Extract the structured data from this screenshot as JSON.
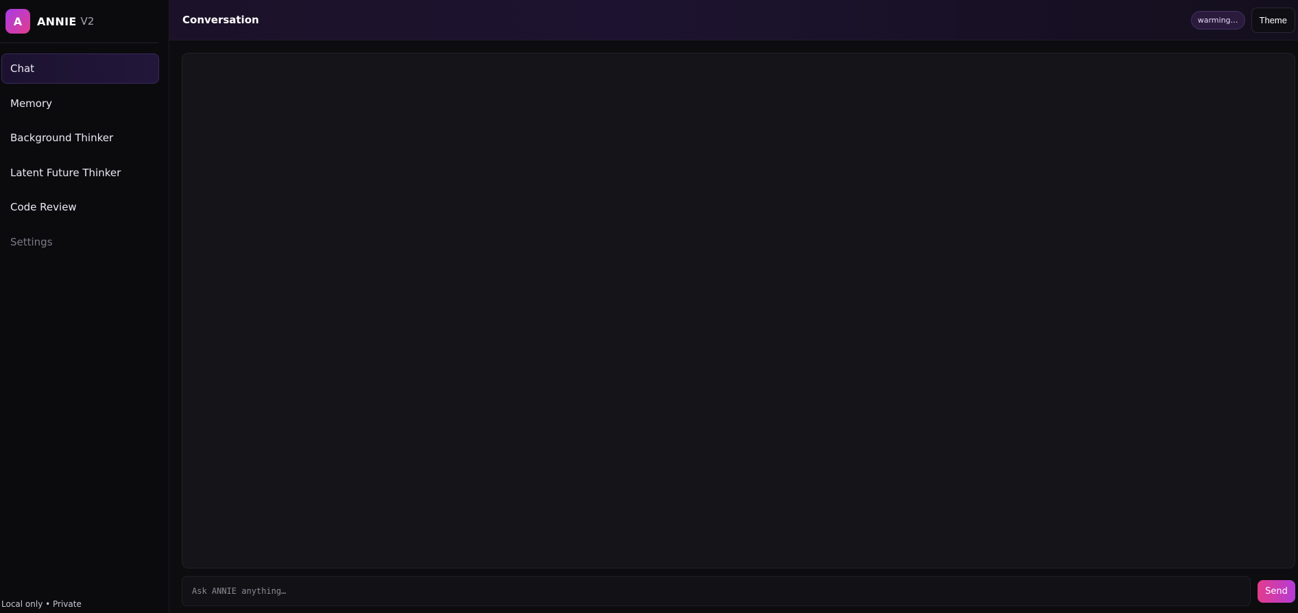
{
  "brand": {
    "logo_letter": "A",
    "name": "ANNIE",
    "version": "V2"
  },
  "sidebar": {
    "items": [
      {
        "label": "Chat",
        "active": true
      },
      {
        "label": "Memory"
      },
      {
        "label": "Background Thinker"
      },
      {
        "label": "Latent Future Thinker"
      },
      {
        "label": "Code Review"
      },
      {
        "label": "Settings",
        "muted": true
      }
    ],
    "footer": "Local only • Private"
  },
  "header": {
    "title": "Conversation",
    "status": "warming…",
    "theme_label": "Theme"
  },
  "composer": {
    "placeholder": "Ask ANNIE anything…",
    "value": "",
    "send_label": "Send"
  },
  "colors": {
    "accent_pink": "#e23c8c",
    "accent_purple": "#a93ce6",
    "background": "#0d0d10"
  }
}
